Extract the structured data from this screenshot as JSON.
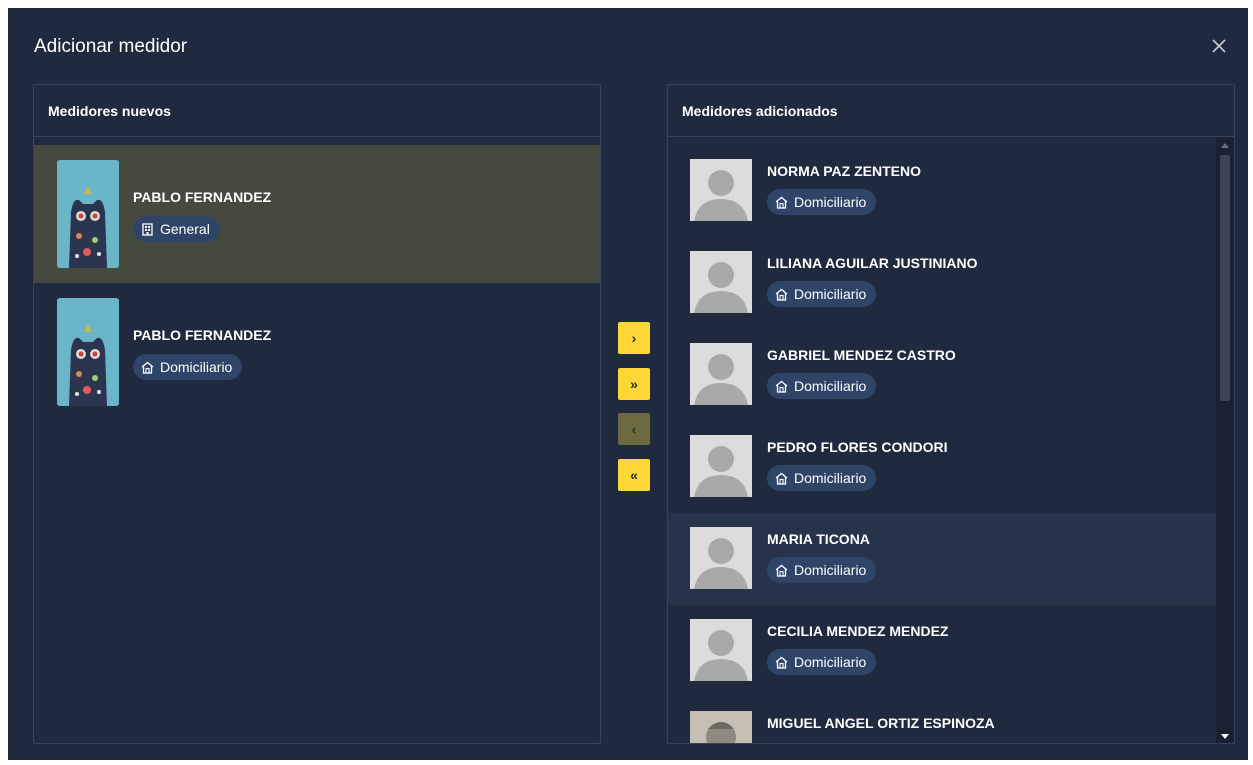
{
  "dialog": {
    "title": "Adicionar medidor",
    "close_icon": "close-icon"
  },
  "left_panel": {
    "header": "Medidores nuevos",
    "items": [
      {
        "name": "PABLO FERNANDEZ",
        "type": "General",
        "type_icon": "building-icon",
        "selected": true
      },
      {
        "name": "PABLO FERNANDEZ",
        "type": "Domiciliario",
        "type_icon": "home-icon",
        "selected": false
      }
    ]
  },
  "transfer_buttons": [
    {
      "label": "›",
      "icon": "chevron-right-icon",
      "enabled": true
    },
    {
      "label": "»",
      "icon": "double-chevron-right-icon",
      "enabled": true
    },
    {
      "label": "‹",
      "icon": "chevron-left-icon",
      "enabled": false
    },
    {
      "label": "«",
      "icon": "double-chevron-left-icon",
      "enabled": true
    }
  ],
  "right_panel": {
    "header": "Medidores adicionados",
    "items": [
      {
        "name": "NORMA PAZ ZENTENO",
        "type": "Domiciliario",
        "type_icon": "home-icon"
      },
      {
        "name": "LILIANA AGUILAR JUSTINIANO",
        "type": "Domiciliario",
        "type_icon": "home-icon"
      },
      {
        "name": "GABRIEL MENDEZ CASTRO",
        "type": "Domiciliario",
        "type_icon": "home-icon"
      },
      {
        "name": "PEDRO FLORES CONDORI",
        "type": "Domiciliario",
        "type_icon": "home-icon"
      },
      {
        "name": "MARIA TICONA",
        "type": "Domiciliario",
        "type_icon": "home-icon"
      },
      {
        "name": "CECILIA MENDEZ MENDEZ",
        "type": "Domiciliario",
        "type_icon": "home-icon"
      },
      {
        "name": "MIGUEL ANGEL ORTIZ ESPINOZA",
        "type": "",
        "type_icon": ""
      }
    ]
  },
  "colors": {
    "background": "#1f2a3e",
    "selected_row": "#45493e",
    "hover_row": "#26334a",
    "chip": "#2e4568",
    "accent": "#fdd835",
    "accent_disabled": "#6b6a3e"
  }
}
